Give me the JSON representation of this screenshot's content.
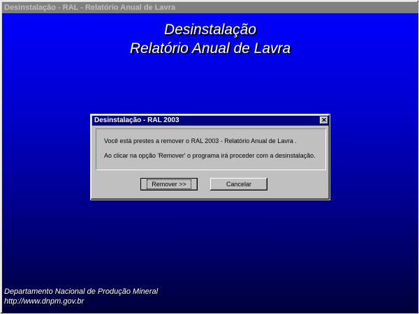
{
  "window": {
    "title": "Desinstalação - RAL - Relatório Anual de Lavra"
  },
  "banner": {
    "line1": "Desinstalação",
    "line2": "Relatório Anual de Lavra"
  },
  "footer": {
    "org": "Departamento Nacional de Produção Mineral",
    "url": "http://www.dnpm.gov.br"
  },
  "dialog": {
    "title": "Desinstalação - RAL 2003",
    "close_glyph": "✕",
    "message1": "Você está prestes a remover o RAL 2003 - Relatório Anual de Lavra .",
    "message2": "Ao clicar na opção 'Remover' o programa irá proceder com a desinstalação.",
    "remove_label": "Remover >>",
    "cancel_label": "Cancelar"
  },
  "colors": {
    "background_top": "#0000ff",
    "background_bottom": "#00003a",
    "dialog_title": "#000080",
    "inactive_title": "#808080"
  }
}
